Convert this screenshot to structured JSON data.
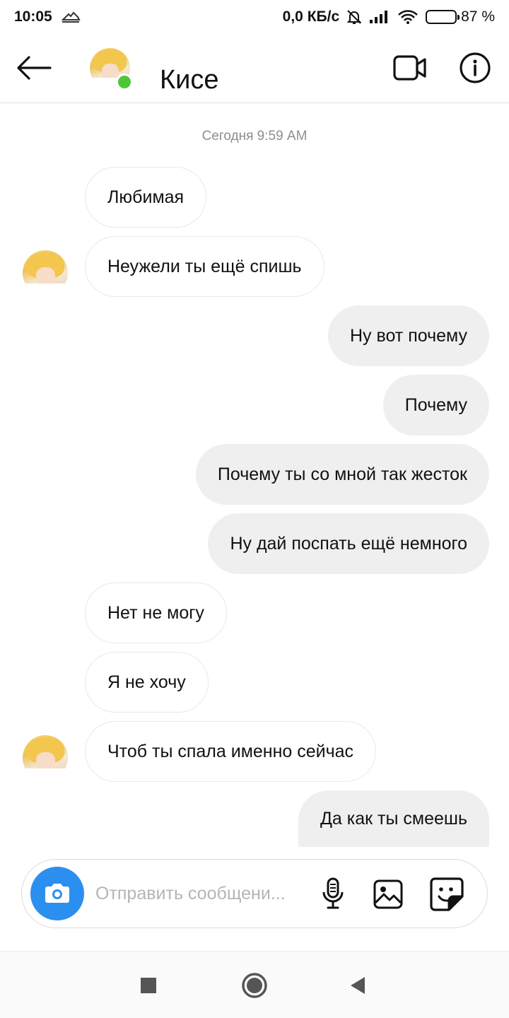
{
  "status_bar": {
    "time": "10:05",
    "net_speed": "0,0 КБ/с",
    "battery_percent": "87 %",
    "battery_level": 0.87,
    "icons": [
      "activity-icon",
      "bell-off-icon",
      "signal-icon",
      "wifi-icon",
      "battery-icon"
    ]
  },
  "header": {
    "contact_name": "Кисе",
    "online": true,
    "online_color": "#4cc733",
    "icons": [
      "back-arrow-icon",
      "video-call-icon",
      "info-icon"
    ]
  },
  "chat": {
    "timestamp": "Сегодня 9:59 AM",
    "messages": [
      {
        "direction": "incoming",
        "text": "Любимая"
      },
      {
        "direction": "incoming",
        "text": "Неужели ты ещё спишь"
      },
      {
        "direction": "outgoing",
        "text": "Ну вот почему"
      },
      {
        "direction": "outgoing",
        "text": "Почему"
      },
      {
        "direction": "outgoing",
        "text": "Почему ты со мной так жесток"
      },
      {
        "direction": "outgoing",
        "text": "Ну дай поспать ещё немного"
      },
      {
        "direction": "incoming",
        "text": "Нет не могу"
      },
      {
        "direction": "incoming",
        "text": "Я не хочу"
      },
      {
        "direction": "incoming",
        "text": "Чтоб ты спала именно сейчас"
      },
      {
        "direction": "outgoing",
        "text": "Да как ты смеешь"
      }
    ]
  },
  "composer": {
    "placeholder": "Отправить сообщени...",
    "value": "",
    "accent_color": "#2b8ff0",
    "icons": [
      "camera-icon",
      "microphone-icon",
      "gallery-icon",
      "sticker-icon"
    ]
  },
  "nav_bar": {
    "icons": [
      "recents-square-icon",
      "home-circle-icon",
      "back-triangle-icon"
    ]
  }
}
